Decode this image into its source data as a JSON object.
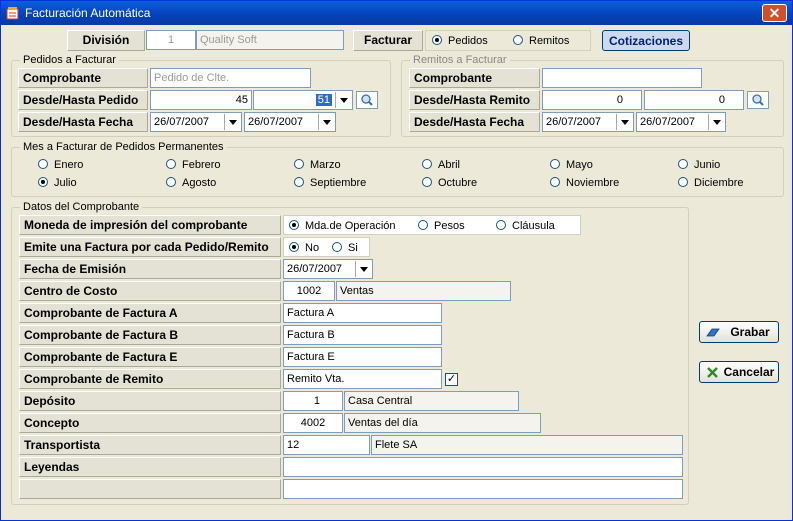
{
  "window": {
    "title": "Facturación Automática",
    "close": "✕"
  },
  "top": {
    "division_label": "División",
    "division_code": "1",
    "division_name": "Quality Soft",
    "facturar_label": "Facturar",
    "opt_pedidos": "Pedidos",
    "opt_remitos": "Remitos",
    "cotizaciones": "Cotizaciones"
  },
  "pedidos": {
    "legend": "Pedidos a Facturar",
    "comprobante_label": "Comprobante",
    "comprobante_value": "Pedido de Clte.",
    "desde_pedido_label": "Desde/Hasta Pedido",
    "desde": "45",
    "hasta": "51",
    "desde_fecha_label": "Desde/Hasta Fecha",
    "fecha_desde": "26/07/2007",
    "fecha_hasta": "26/07/2007"
  },
  "remitos": {
    "legend": "Remitos a Facturar",
    "comprobante_label": "Comprobante",
    "comprobante_value": "",
    "desde_remito_label": "Desde/Hasta Remito",
    "desde": "0",
    "hasta": "0",
    "desde_fecha_label": "Desde/Hasta Fecha",
    "fecha_desde": "26/07/2007",
    "fecha_hasta": "26/07/2007"
  },
  "mes": {
    "legend": "Mes a Facturar de Pedidos Permanentes",
    "months": [
      "Enero",
      "Febrero",
      "Marzo",
      "Abril",
      "Mayo",
      "Junio",
      "Julio",
      "Agosto",
      "Septiembre",
      "Octubre",
      "Noviembre",
      "Diciembre"
    ],
    "selected": "Julio"
  },
  "datos": {
    "legend": "Datos del Comprobante",
    "moneda_label": "Moneda de impresión del comprobante",
    "moneda_opts": [
      "Mda.de Operación",
      "Pesos",
      "Cláusula"
    ],
    "emite_label": "Emite una Factura por cada Pedido/Remito",
    "emite_opts": [
      "No",
      "Si"
    ],
    "fecha_label": "Fecha de Emisión",
    "fecha_value": "26/07/2007",
    "centro_label": "Centro de Costo",
    "centro_code": "1002",
    "centro_name": "Ventas",
    "facA_label": "Comprobante de Factura A",
    "facA_value": "Factura A",
    "facB_label": "Comprobante de Factura B",
    "facB_value": "Factura B",
    "facE_label": "Comprobante de Factura E",
    "facE_value": "Factura E",
    "remito_label": "Comprobante de Remito",
    "remito_value": "Remito Vta.",
    "remito_check": "✓",
    "deposito_label": "Depósito",
    "deposito_code": "1",
    "deposito_name": "Casa Central",
    "concepto_label": "Concepto",
    "concepto_code": "4002",
    "concepto_name": "Ventas del día",
    "transp_label": "Transportista",
    "transp_code": "12",
    "transp_name": "Flete SA",
    "leyendas_label": "Leyendas",
    "leyenda1": "",
    "leyenda2": ""
  },
  "actions": {
    "grabar": "Grabar",
    "cancelar": "Cancelar"
  }
}
